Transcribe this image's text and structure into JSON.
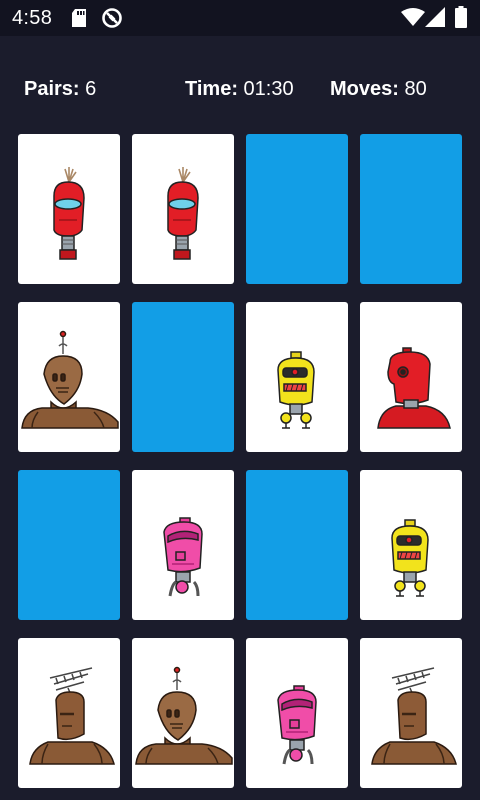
{
  "status_bar": {
    "time": "4:58",
    "icons": [
      "sd-card-icon",
      "do-not-disturb-icon",
      "wifi-icon",
      "cell-signal-icon",
      "battery-icon"
    ]
  },
  "stats": {
    "pairs_label": "Pairs:",
    "pairs_value": "6",
    "time_label": "Time:",
    "time_value": "01:30",
    "moves_label": "Moves:",
    "moves_value": "80"
  },
  "colors": {
    "background": "#1b1c2c",
    "card_back": "#129ee6",
    "card_face": "#ffffff"
  },
  "cards": [
    {
      "state": "revealed",
      "robot": "red-visor-robot"
    },
    {
      "state": "revealed",
      "robot": "red-visor-robot"
    },
    {
      "state": "hidden"
    },
    {
      "state": "hidden"
    },
    {
      "state": "revealed",
      "robot": "brown-antenna-robot"
    },
    {
      "state": "hidden"
    },
    {
      "state": "revealed",
      "robot": "yellow-robot"
    },
    {
      "state": "revealed",
      "robot": "red-cyclops-robot"
    },
    {
      "state": "hidden"
    },
    {
      "state": "revealed",
      "robot": "pink-robot"
    },
    {
      "state": "hidden"
    },
    {
      "state": "revealed",
      "robot": "yellow-robot"
    },
    {
      "state": "revealed",
      "robot": "brown-tv-antenna-robot"
    },
    {
      "state": "revealed",
      "robot": "brown-antenna-robot"
    },
    {
      "state": "revealed",
      "robot": "pink-robot"
    },
    {
      "state": "revealed",
      "robot": "brown-tv-antenna-robot"
    }
  ]
}
